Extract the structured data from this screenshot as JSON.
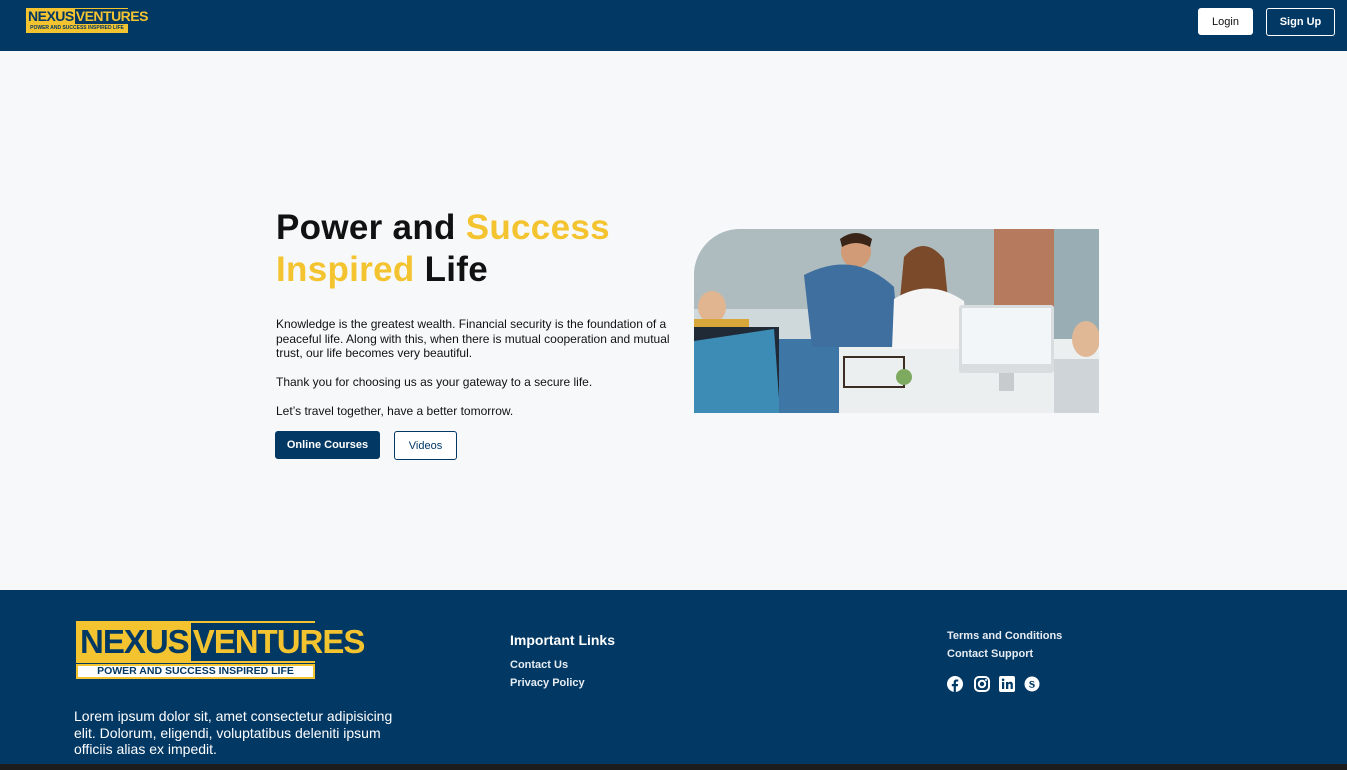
{
  "brand": {
    "name_part1": "NEXUS",
    "name_part2": "VENTURES",
    "tagline": "POWER AND SUCCESS INSPIRED LIFE",
    "primary_color": "#023864",
    "accent_color": "#f4c430"
  },
  "nav": {
    "login_label": "Login",
    "signup_label": "Sign Up"
  },
  "hero": {
    "title_word1": "Power and ",
    "title_word2": "Success",
    "title_word3": "Inspired",
    "title_word4": " Life",
    "paragraph1": "Knowledge is the greatest wealth. Financial security is the foundation of a peaceful life. Along with this, when there is mutual cooperation and mutual trust, our life becomes very beautiful.",
    "paragraph2": "Thank you for choosing us as your gateway to a secure life.",
    "paragraph3": "Let’s travel together, have a better tomorrow.",
    "courses_button": "Online Courses",
    "videos_button": "Videos"
  },
  "footer": {
    "description": "Lorem ipsum dolor sit, amet consectetur adipisicing elit. Dolorum, eligendi, voluptatibus deleniti ipsum officiis alias ex impedit.",
    "links_title": "Important Links",
    "link_contact": "Contact Us",
    "link_privacy": "Privacy Policy",
    "link_terms": "Terms and Conditions",
    "link_support": "Contact Support",
    "social_icons": [
      "facebook-icon",
      "instagram-icon",
      "linkedin-icon",
      "skype-icon"
    ]
  }
}
